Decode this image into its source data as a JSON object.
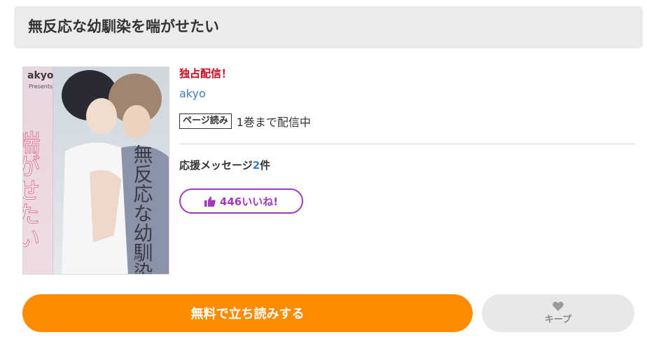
{
  "title": "無反応な幼馴染を喘がせたい",
  "cover": {
    "author_mark": "akyo",
    "presents": "Presents",
    "vertical_title_top": "喘がせたい",
    "vertical_title_bottom": "無反応な幼馴染を"
  },
  "badge": "独占配信！",
  "author": "akyo",
  "format": {
    "tag": "ページ読み",
    "status": "1巻まで配信中"
  },
  "cheer": {
    "prefix": "応援メッセージ",
    "count": "2",
    "suffix": "件"
  },
  "like_button": {
    "label": "446いいね!"
  },
  "read_button": {
    "label": "無料で立ち読みする"
  },
  "keep_button": {
    "label": "キープ"
  },
  "colors": {
    "accent_orange": "#ff8c00",
    "like_purple": "#a238c2",
    "exclusive_red": "#d0021b",
    "link_blue": "#3f7fbf"
  }
}
